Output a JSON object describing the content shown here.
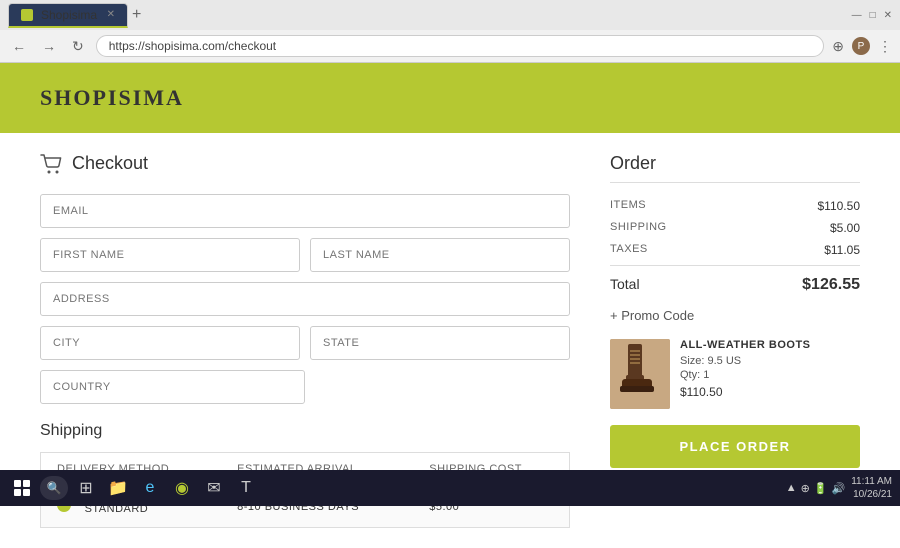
{
  "browser": {
    "tab_title": "Shopisima",
    "url": "https://shopisima.com/checkout",
    "favicon_color": "#b5c832"
  },
  "header": {
    "logo": "SHOPISIMA"
  },
  "checkout": {
    "title": "Checkout",
    "fields": {
      "email_placeholder": "EMAIL",
      "first_name_placeholder": "FIRST NAME",
      "last_name_placeholder": "LAST NAME",
      "address_placeholder": "ADDRESS",
      "city_placeholder": "CITY",
      "state_placeholder": "STATE",
      "country_placeholder": "COUNTRY"
    },
    "shipping_title": "Shipping",
    "shipping_table": {
      "headers": [
        "DELIVERY METHOD",
        "ESTIMATED ARRIVAL",
        "SHIPPING COST"
      ],
      "rows": [
        {
          "method": "STANDARD",
          "arrival": "8-10 BUSINESS DAYS",
          "cost": "$5.00",
          "selected": true
        }
      ]
    }
  },
  "order": {
    "title": "Order",
    "items_label": "ITEMS",
    "items_value": "$110.50",
    "shipping_label": "SHIPPING",
    "shipping_value": "$5.00",
    "taxes_label": "TAXES",
    "taxes_value": "$11.05",
    "total_label": "Total",
    "total_value": "$126.55",
    "promo_label": "+ Promo Code",
    "product": {
      "name": "ALL-WEATHER BOOTS",
      "size": "Size: 9.5 US",
      "qty": "Qty: 1",
      "price": "$110.50"
    },
    "place_order_label": "PLACE ORDER"
  },
  "taskbar": {
    "time": "11:11 AM",
    "date": "10/26/21",
    "systray_icons": [
      "▲",
      "⊕",
      "🔋",
      "🔊"
    ]
  }
}
